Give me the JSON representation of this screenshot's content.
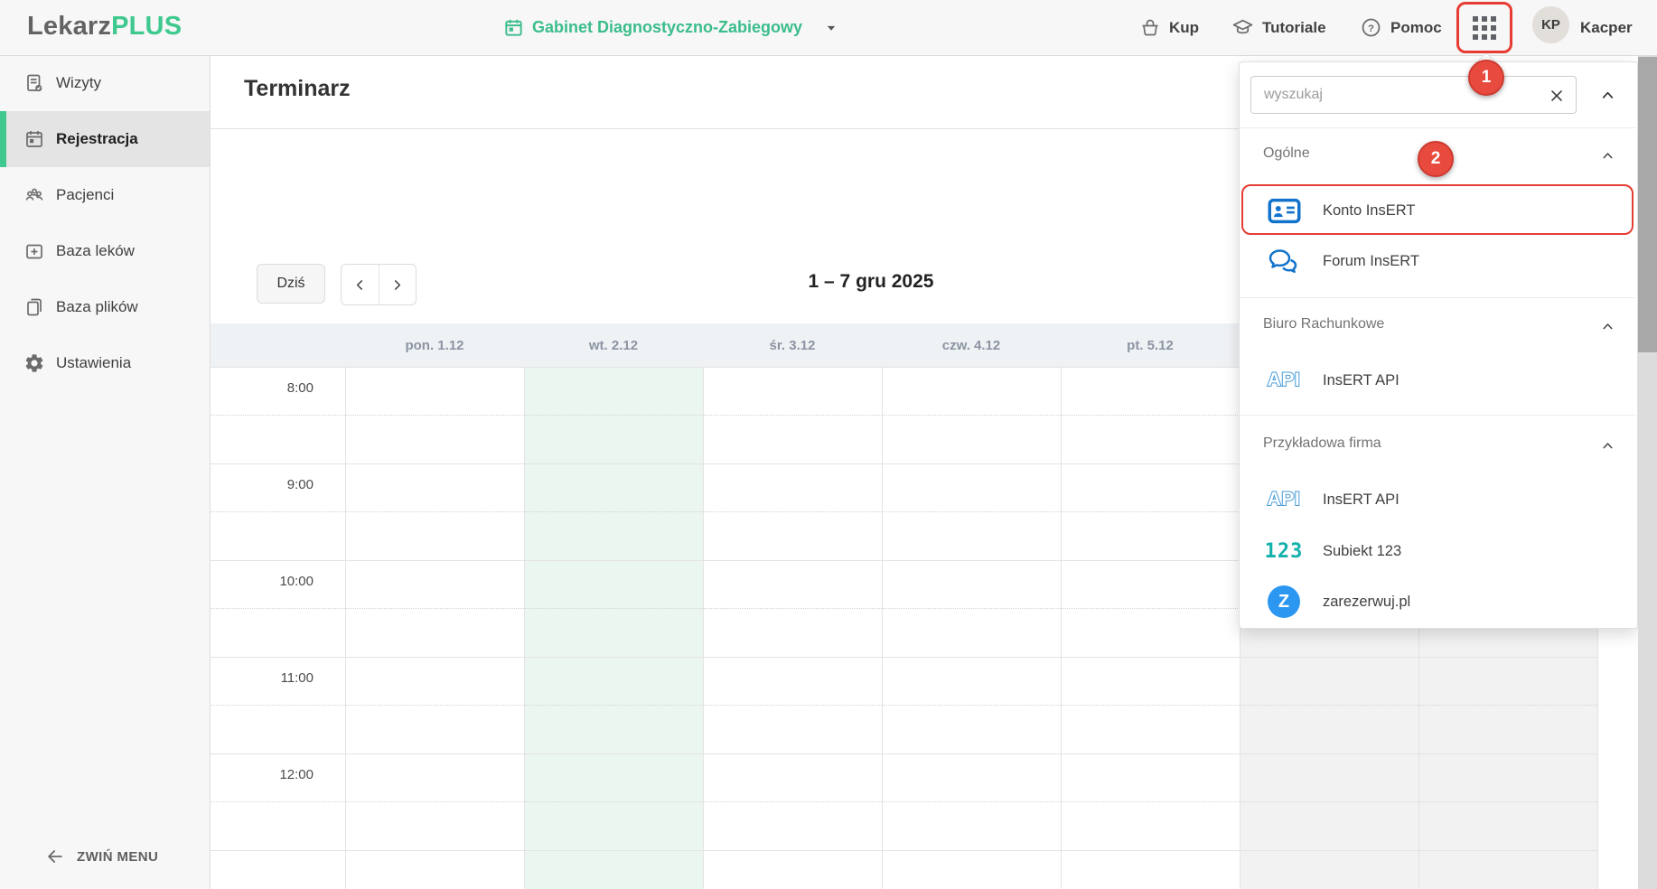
{
  "header": {
    "logo_part1": "Lekarz",
    "logo_part2": "PLUS",
    "office_selector_label": "Gabinet Diagnostyczno-Zabiegowy",
    "nav": [
      {
        "label": "Kup",
        "icon": "basket-icon"
      },
      {
        "label": "Tutoriale",
        "icon": "graduation-cap-icon"
      },
      {
        "label": "Pomoc",
        "icon": "help-circle-icon"
      }
    ],
    "user": {
      "initials": "KP",
      "name": "Kacper"
    }
  },
  "sidebar": {
    "items": [
      {
        "label": "Wizyty",
        "icon": "visits-note-icon",
        "active": false
      },
      {
        "label": "Rejestracja",
        "icon": "calendar-icon",
        "active": true
      },
      {
        "label": "Pacjenci",
        "icon": "patients-icon",
        "active": false
      },
      {
        "label": "Baza leków",
        "icon": "medicine-box-icon",
        "active": false
      },
      {
        "label": "Baza plików",
        "icon": "files-icon",
        "active": false
      },
      {
        "label": "Ustawienia",
        "icon": "settings-gear-icon",
        "active": false
      }
    ],
    "collapse_label": "ZWIŃ MENU"
  },
  "page": {
    "title": "Terminarz"
  },
  "calendar": {
    "today_button": "Dziś",
    "range_label": "1 – 7 gru 2025",
    "day_headers": [
      "pon. 1.12",
      "wt. 2.12",
      "śr. 3.12",
      "czw. 4.12",
      "pt. 5.12"
    ],
    "time_labels": [
      "8:00",
      "9:00",
      "10:00",
      "11:00",
      "12:00"
    ]
  },
  "apps_panel": {
    "search_placeholder": "wyszukaj",
    "sections": [
      {
        "title": "Ogólne",
        "items": [
          {
            "label": "Konto InsERT",
            "icon": "id-card-icon"
          },
          {
            "label": "Forum InsERT",
            "icon": "forum-bubbles-icon"
          }
        ]
      },
      {
        "title": "Biuro Rachunkowe",
        "items": [
          {
            "label": "InsERT API",
            "icon": "api-logo"
          }
        ]
      },
      {
        "title": "Przykładowa firma",
        "items": [
          {
            "label": "InsERT API",
            "icon": "api-logo"
          },
          {
            "label": "Subiekt 123",
            "icon": "subiekt-123-logo"
          },
          {
            "label": "zarezerwuj.pl",
            "icon": "zarezerwuj-logo"
          }
        ]
      }
    ]
  },
  "annotations": {
    "step1_badge": "1",
    "step2_badge": "2"
  },
  "colors": {
    "accent_green": "#3fc98f",
    "annotation_red": "#e63c33",
    "icon_blue": "#1273cc",
    "subiekt_teal": "#14b0ac",
    "zarezerwuj_blue": "#2b97f1",
    "today_column": "#ebf6f0",
    "weekend_column": "#f2f2f2"
  }
}
